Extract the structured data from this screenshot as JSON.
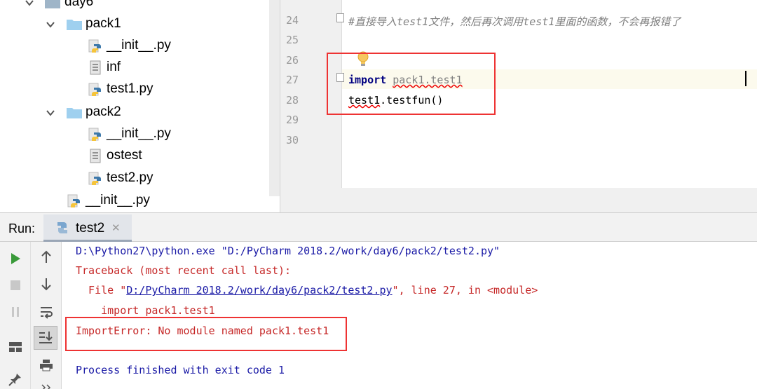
{
  "project_tree": {
    "items": [
      {
        "label": "day6",
        "type": "folder",
        "expanded": true
      },
      {
        "label": "pack1",
        "type": "folder",
        "expanded": true
      },
      {
        "label": "__init__.py",
        "type": "python-file"
      },
      {
        "label": "inf",
        "type": "text-file"
      },
      {
        "label": "test1.py",
        "type": "python-file"
      },
      {
        "label": "pack2",
        "type": "folder",
        "expanded": true
      },
      {
        "label": "__init__.py",
        "type": "python-file"
      },
      {
        "label": "ostest",
        "type": "text-file"
      },
      {
        "label": "test2.py",
        "type": "python-file"
      },
      {
        "label": "__init__.py",
        "type": "python-file"
      }
    ]
  },
  "editor": {
    "line_numbers": [
      "24",
      "25",
      "26",
      "27",
      "28",
      "29",
      "30"
    ],
    "comment": "#直接导入test1文件，然后再次调用test1里面的函数，不会再报错了",
    "import_keyword": "import",
    "import_module": "pack1.test1",
    "call_object": "test1",
    "call_rest": ".testfun()",
    "current_line": "27"
  },
  "run_panel": {
    "title": "Run:",
    "tab_label": "test2",
    "tab_close": "✕",
    "console": {
      "command": "D:\\Python27\\python.exe \"D:/PyCharm 2018.2/work/day6/pack2/test2.py\"",
      "traceback_header": "Traceback (most recent call last):",
      "file_prefix": "  File \"",
      "file_link": "D:/PyCharm 2018.2/work/day6/pack2/test2.py",
      "file_suffix": "\", line 27, in <module>",
      "source_line": "    import pack1.test1",
      "error": "ImportError: No module named pack1.test1",
      "exit": "Process finished with exit code 1"
    }
  },
  "colors": {
    "highlight_box": "#ee3333",
    "keyword": "#000080",
    "console_blue": "#1a1aa6",
    "console_red": "#c62828",
    "run_green": "#3a9a3a"
  }
}
